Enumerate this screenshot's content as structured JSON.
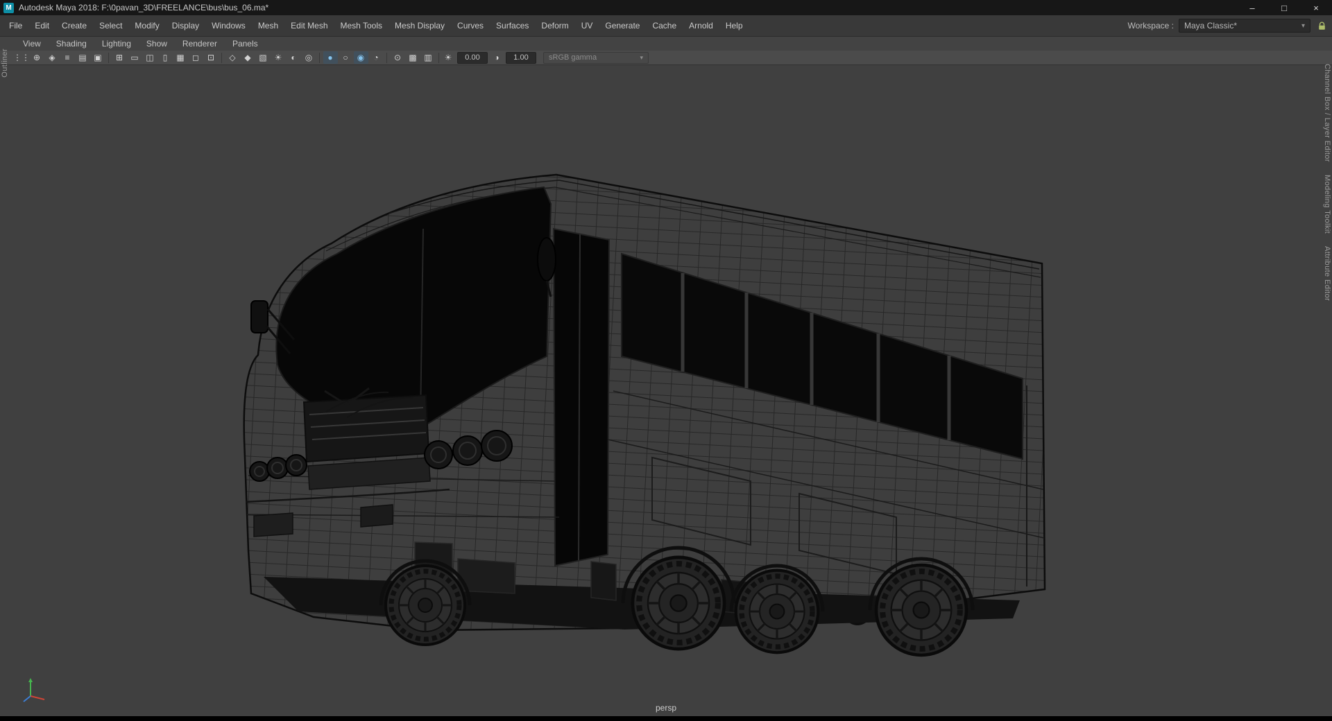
{
  "window": {
    "title": "Autodesk Maya 2018: F:\\0pavan_3D\\FREELANCE\\bus\\bus_06.ma*",
    "logo_letter": "M",
    "controls": {
      "minimize": "–",
      "maximize": "□",
      "close": "×"
    }
  },
  "menubar": {
    "items": [
      "File",
      "Edit",
      "Create",
      "Select",
      "Modify",
      "Display",
      "Windows",
      "Mesh",
      "Edit Mesh",
      "Mesh Tools",
      "Mesh Display",
      "Curves",
      "Surfaces",
      "Deform",
      "UV",
      "Generate",
      "Cache",
      "Arnold",
      "Help"
    ],
    "workspace": {
      "label": "Workspace :",
      "value": "Maya Classic*",
      "arrow": "▾"
    }
  },
  "panel": {
    "menus": [
      "View",
      "Shading",
      "Lighting",
      "Show",
      "Renderer",
      "Panels"
    ],
    "toolbar": {
      "icons": [
        {
          "name": "toolbar-grip",
          "glyph": "⋮⋮"
        },
        {
          "name": "select-camera-icon",
          "glyph": "⊕"
        },
        {
          "name": "lock-camera-icon",
          "glyph": "◈"
        },
        {
          "name": "camera-attributes-icon",
          "glyph": "≡"
        },
        {
          "name": "bookmark-icon",
          "glyph": "▤"
        },
        {
          "name": "image-plane-icon",
          "glyph": "▣"
        },
        {
          "sep": true
        },
        {
          "name": "grid-icon",
          "glyph": "⊞"
        },
        {
          "name": "film-gate-icon",
          "glyph": "▭"
        },
        {
          "name": "resolution-gate-icon",
          "glyph": "◫"
        },
        {
          "name": "gate-mask-icon",
          "glyph": "▯"
        },
        {
          "name": "field-chart-icon",
          "glyph": "▦"
        },
        {
          "name": "safe-action-icon",
          "glyph": "◻"
        },
        {
          "name": "safe-title-icon",
          "glyph": "⊡"
        },
        {
          "sep": true
        },
        {
          "name": "wireframe-icon",
          "glyph": "◇"
        },
        {
          "name": "smooth-shade-icon",
          "glyph": "◆"
        },
        {
          "name": "textured-icon",
          "glyph": "▧"
        },
        {
          "name": "use-all-lights-icon",
          "glyph": "☀"
        },
        {
          "name": "shadows-icon",
          "glyph": "◐"
        },
        {
          "name": "occlusion-icon",
          "glyph": "◎"
        },
        {
          "sep": true
        },
        {
          "name": "lighting-sphere-icon",
          "glyph": "●",
          "active": true
        },
        {
          "name": "flat-lighting-icon",
          "glyph": "○"
        },
        {
          "name": "ssao-icon",
          "glyph": "◉",
          "active": true
        },
        {
          "name": "motion-blur-icon",
          "glyph": "◔"
        },
        {
          "sep": true
        },
        {
          "name": "isolate-select-icon",
          "glyph": "⊙"
        },
        {
          "name": "x-ray-icon",
          "glyph": "▩"
        },
        {
          "name": "wireframe-on-shaded-icon",
          "glyph": "▥"
        },
        {
          "sep": true
        }
      ],
      "exposure_icon": "☀",
      "exposure_value": "0.00",
      "contrast_icon": "◑",
      "contrast_value": "1.00",
      "colorspace": {
        "value": "sRGB gamma",
        "arrow": "▾"
      }
    }
  },
  "side_tabs": {
    "left": [
      "Outliner"
    ],
    "right": [
      "Channel Box / Layer Editor",
      "Modeling Toolkit",
      "Attribute Editor"
    ]
  },
  "viewport": {
    "camera": "persp"
  },
  "colors": {
    "viewport_bg": "#404040",
    "active_icon": "#84c2ec",
    "accent_teal": "#0e8fa6"
  }
}
